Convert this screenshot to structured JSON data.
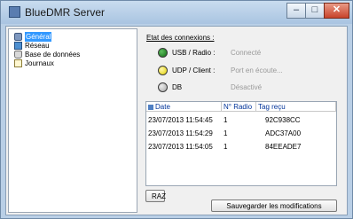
{
  "window": {
    "title": "BlueDMR Server"
  },
  "sidebar": {
    "items": [
      {
        "label": "Général",
        "icon": "gear-icon",
        "selected": true
      },
      {
        "label": "Réseau",
        "icon": "network-icon"
      },
      {
        "label": "Base de données",
        "icon": "database-icon"
      },
      {
        "label": "Journaux",
        "icon": "log-icon"
      }
    ]
  },
  "connections": {
    "title": "Etat des connexions :",
    "items": [
      {
        "label": "USB / Radio :",
        "status": "Connecté",
        "led_color": "#1f8a1f"
      },
      {
        "label": "UDP / Client :",
        "status": "Port en écoute...",
        "led_color": "#f2e600"
      },
      {
        "label": "DB",
        "status": "Désactivé",
        "led_color": "#cfcfcf"
      }
    ]
  },
  "log": {
    "columns": [
      "Date",
      "N° Radio",
      "Tag reçu"
    ],
    "rows": [
      {
        "date": "23/07/2013 11:54:45",
        "radio": "1",
        "tag": "92C938CC"
      },
      {
        "date": "23/07/2013 11:54:29",
        "radio": "1",
        "tag": "ADC37A00"
      },
      {
        "date": "23/07/2013 11:54:05",
        "radio": "1",
        "tag": "84EEADE7"
      }
    ]
  },
  "buttons": {
    "raz": "RAZ",
    "save": "Sauvegarder les modifications"
  },
  "colors": {
    "selection": "#3399ff",
    "header_text": "#003399",
    "status_text": "#9a9a9a"
  }
}
